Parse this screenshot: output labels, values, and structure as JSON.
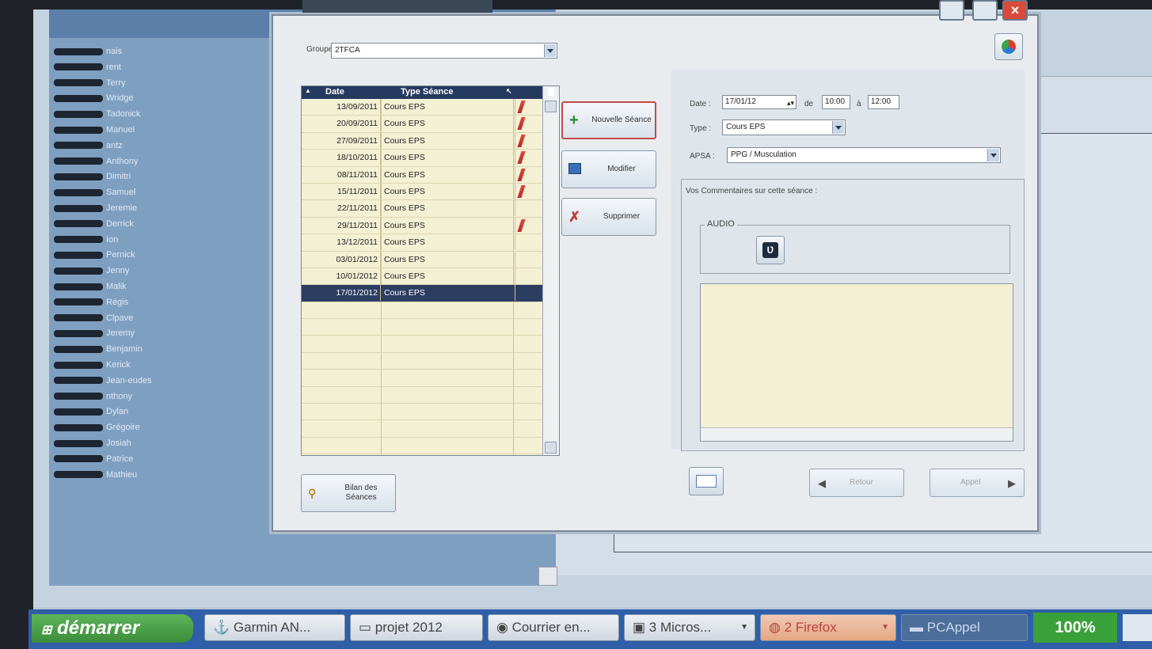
{
  "dialog": {
    "group_label": "Groupe",
    "group_value": "2TFCA"
  },
  "grid": {
    "col_date": "Date",
    "col_type": "Type Séance",
    "rows": [
      {
        "date": "13/09/2011",
        "type": "Cours EPS",
        "mark": true
      },
      {
        "date": "20/09/2011",
        "type": "Cours EPS",
        "mark": true
      },
      {
        "date": "27/09/2011",
        "type": "Cours EPS",
        "mark": true
      },
      {
        "date": "18/10/2011",
        "type": "Cours EPS",
        "mark": true
      },
      {
        "date": "08/11/2011",
        "type": "Cours EPS",
        "mark": true
      },
      {
        "date": "15/11/2011",
        "type": "Cours EPS",
        "mark": true
      },
      {
        "date": "22/11/2011",
        "type": "Cours EPS",
        "mark": false
      },
      {
        "date": "29/11/2011",
        "type": "Cours EPS",
        "mark": true
      },
      {
        "date": "13/12/2011",
        "type": "Cours EPS",
        "mark": false
      },
      {
        "date": "03/01/2012",
        "type": "Cours EPS",
        "mark": false
      },
      {
        "date": "10/01/2012",
        "type": "Cours EPS",
        "mark": false
      },
      {
        "date": "17/01/2012",
        "type": "Cours EPS",
        "mark": false,
        "selected": true
      }
    ]
  },
  "actions": {
    "new_label": "Nouvelle Séance",
    "edit_label": "Modifier",
    "delete_label": "Supprimer",
    "summary_label": "Bilan des Séances"
  },
  "session": {
    "date_label": "Date :",
    "date_value": "17/01/12",
    "from_label": "de",
    "from_value": "10:00",
    "to_label": "à",
    "to_value": "12:00",
    "type_label": "Type :",
    "type_value": "Cours EPS",
    "apsa_label": "APSA :",
    "apsa_value": "PPG / Musculation",
    "comments_label": "Vos Commentaires sur cette séance :",
    "audio_label": "AUDIO",
    "back_label": "Retour",
    "next_label": "Appel"
  },
  "students": [
    "nais",
    "rent",
    "Terry",
    "Wridge",
    "Tadonick",
    "Manuel",
    "antz",
    "Anthony",
    "Dimitri",
    "Samuel",
    "Jeremie",
    "Derrick",
    "Ion",
    "Pernick",
    "Jenny",
    "Malik",
    "Régis",
    "Clpave",
    "Jeremy",
    "Benjamin",
    "Kerick",
    "Jean-eudes",
    "nthony",
    "Dylan",
    "Grégoire",
    "Josiah",
    "Patrice",
    "Mathieu"
  ],
  "taskbar": {
    "start_label": "démarrer",
    "tasks": [
      "Garmin AN...",
      "projet 2012",
      "Courrier en...",
      "3 Micros...",
      "2 Firefox",
      "PCAppel"
    ],
    "zoom": "100%"
  }
}
